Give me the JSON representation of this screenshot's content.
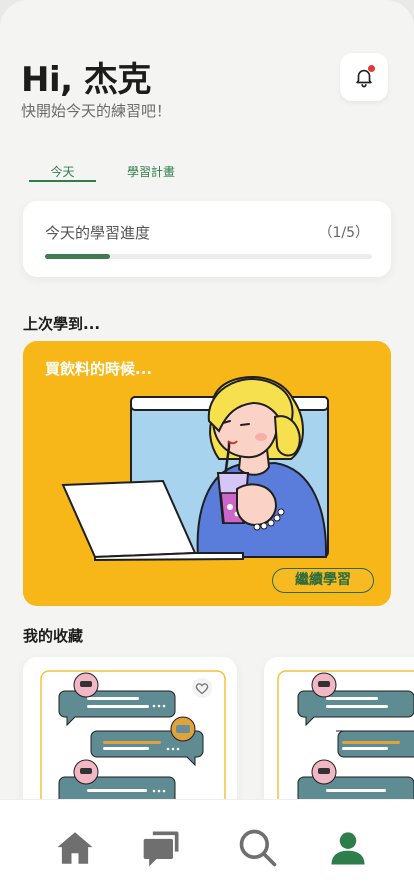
{
  "header": {
    "greeting": "Hi, 杰克",
    "subtitle": "快開始今天的練習吧！",
    "bell_icon": "bell-icon",
    "has_notification": true
  },
  "tabs": [
    {
      "label": "今天",
      "active": true
    },
    {
      "label": "學習計畫",
      "active": false
    }
  ],
  "progress": {
    "label": "今天的學習進度",
    "count": "（1/5）",
    "fraction": 0.2
  },
  "last_learned": {
    "section_title": "上次學到...",
    "card_title": "買飲料的時候...",
    "continue_label": "繼續學習"
  },
  "favorites": {
    "section_title": "我的收藏",
    "heart_icon": "heart-outline-icon"
  },
  "bottom_nav": [
    {
      "icon": "home-icon",
      "active": false
    },
    {
      "icon": "chat-icon",
      "active": false
    },
    {
      "icon": "search-icon",
      "active": false
    },
    {
      "icon": "profile-icon",
      "active": true
    }
  ],
  "colors": {
    "accent_green": "#2f7d4b",
    "hero_yellow": "#f7b718",
    "nav_inactive": "#6f6f6f",
    "notification_red": "#e53935"
  }
}
